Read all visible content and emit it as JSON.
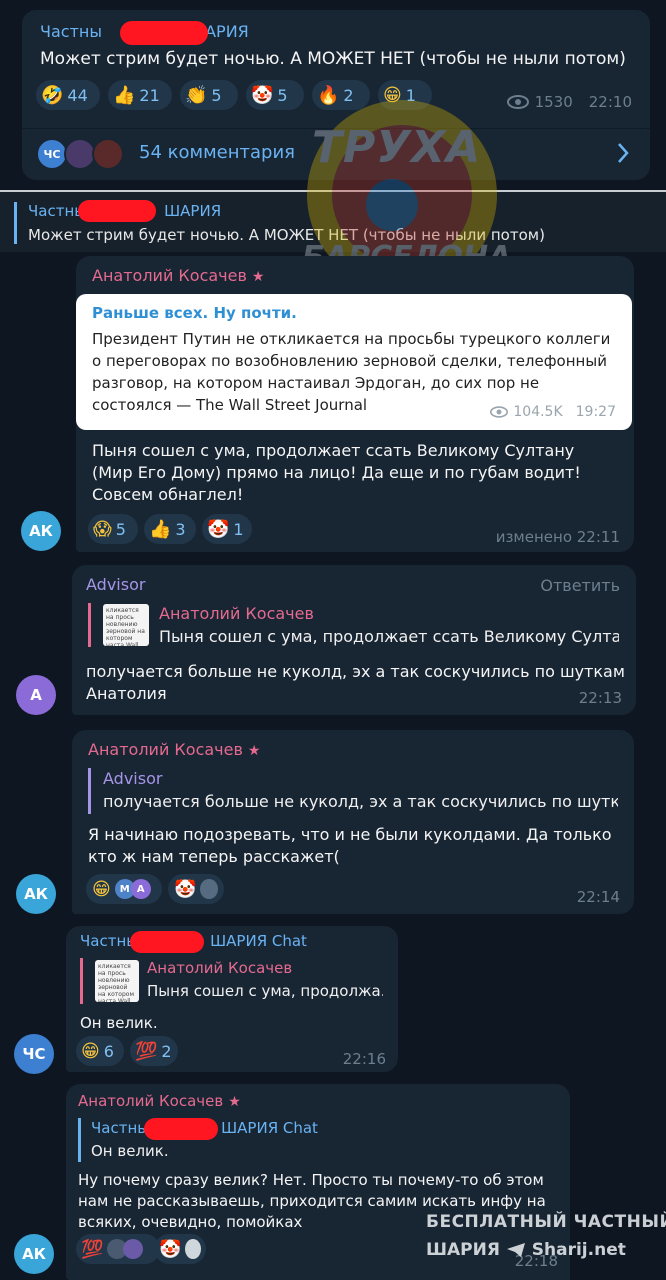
{
  "channel_post": {
    "author_prefix": "Частны",
    "author_suffix": "ШАРИЯ",
    "text": "Может стрим будет ночью. А МОЖЕТ НЕТ (чтобы не ныли потом)",
    "reactions": [
      {
        "icon": "rofl-emoji",
        "glyph": "🤣",
        "count": "44"
      },
      {
        "icon": "thumbs-up-emoji",
        "glyph": "👍",
        "count": "21"
      },
      {
        "icon": "clap-emoji",
        "glyph": "👏",
        "count": "5"
      },
      {
        "icon": "clown-emoji",
        "glyph": "🤡",
        "count": "5"
      },
      {
        "icon": "fire-emoji",
        "glyph": "🔥",
        "count": "2"
      },
      {
        "icon": "grin-emoji",
        "glyph": "😁",
        "count": "1"
      }
    ],
    "views": "1530",
    "time": "22:10",
    "comments_label": "54 комментария",
    "comment_avatar_initials": "ЧС"
  },
  "pinned": {
    "author_prefix": "Частны",
    "author_suffix": "ШАРИЯ",
    "text": "Может стрим будет ночью. А МОЖЕТ НЕТ (чтобы не ныли потом)"
  },
  "watermark": {
    "line1": "ТРУХА",
    "line2": "БАРСЕЛОНА"
  },
  "messages": [
    {
      "sender": "Анатолий Косачев",
      "forward": {
        "source": "Раньше всех. Ну почти.",
        "text": "Президент Путин не откликается на просьбы турецкого коллеги о переговорах по возобновлению зерновой сделки, телефонный разговор, на котором настаивал Эрдоган, до сих пор не состоялся — The Wall Street Journal",
        "views": "104.5K",
        "time": "19:27"
      },
      "text": "Пыня сошел с ума, продолжает ссать Великому Султану (Мир Его Дому) прямо на лицо! Да еще и по губам водит! Совсем обнаглел!",
      "reactions": [
        {
          "icon": "scream-emoji",
          "glyph": "😱",
          "count": "5"
        },
        {
          "icon": "thumbs-up-emoji",
          "glyph": "👍",
          "count": "3"
        },
        {
          "icon": "clown-emoji",
          "glyph": "🤡",
          "count": "1"
        }
      ],
      "edited_time": "изменено 22:11",
      "avatar": "АК"
    },
    {
      "sender": "Advisor",
      "reply_action": "Ответить",
      "reply_to": {
        "name": "Анатолий Косачев",
        "text": "Пыня сошел с ума, продолжает ссать Великому Султа..."
      },
      "text": "получается больше не куколд, эх а так соскучились по шуткам Анатолия",
      "time": "22:13",
      "avatar": "А"
    },
    {
      "sender": "Анатолий Косачев",
      "reply_to": {
        "name": "Advisor",
        "text": "получается больше не куколд, эх а так соскучились по шутка..."
      },
      "text": "Я начинаю подозревать, что и не были куколдами. Да только кто ж нам теперь расскажет(",
      "reactor_initials": [
        "М",
        "А"
      ],
      "time": "22:14",
      "avatar": "АК"
    },
    {
      "sender_prefix": "Частны",
      "sender_suffix": "ШАРИЯ Chat",
      "reply_to": {
        "name": "Анатолий Косачев",
        "text": "Пыня сошел с ума, продолжа..."
      },
      "text": "Он велик.",
      "reactions": [
        {
          "icon": "grin-emoji",
          "glyph": "😁",
          "count": "6"
        },
        {
          "icon": "hundred-emoji",
          "glyph": "💯",
          "count": "2"
        }
      ],
      "time": "22:16",
      "avatar": "ЧС"
    },
    {
      "sender": "Анатолий Косачев",
      "reply_to": {
        "name_prefix": "Частны",
        "name_suffix": "ШАРИЯ Chat",
        "text": "Он велик."
      },
      "text": "Ну почему сразу велик? Нет. Просто ты почему-то об этом нам не рассказываешь, приходится самим искать инфу на всяких, очевидно, помойках",
      "time": "22:18",
      "avatar": "АК"
    }
  ],
  "thumb_text": "кликается на прось новлению зерновой на котором наста Wall Street Journal",
  "corner_watermark": {
    "line1": "БЕСПЛАТНЫЙ ЧАСТНЫЙ",
    "line2": "ШАРИЯ",
    "site": "Sharij.net"
  },
  "colors": {
    "background": "#0e1621",
    "bubble": "#182533",
    "accent_blue": "#6ab3f3",
    "pink_name": "#e56a8f",
    "purple_name": "#a695e7",
    "redaction": "#ff1620"
  }
}
